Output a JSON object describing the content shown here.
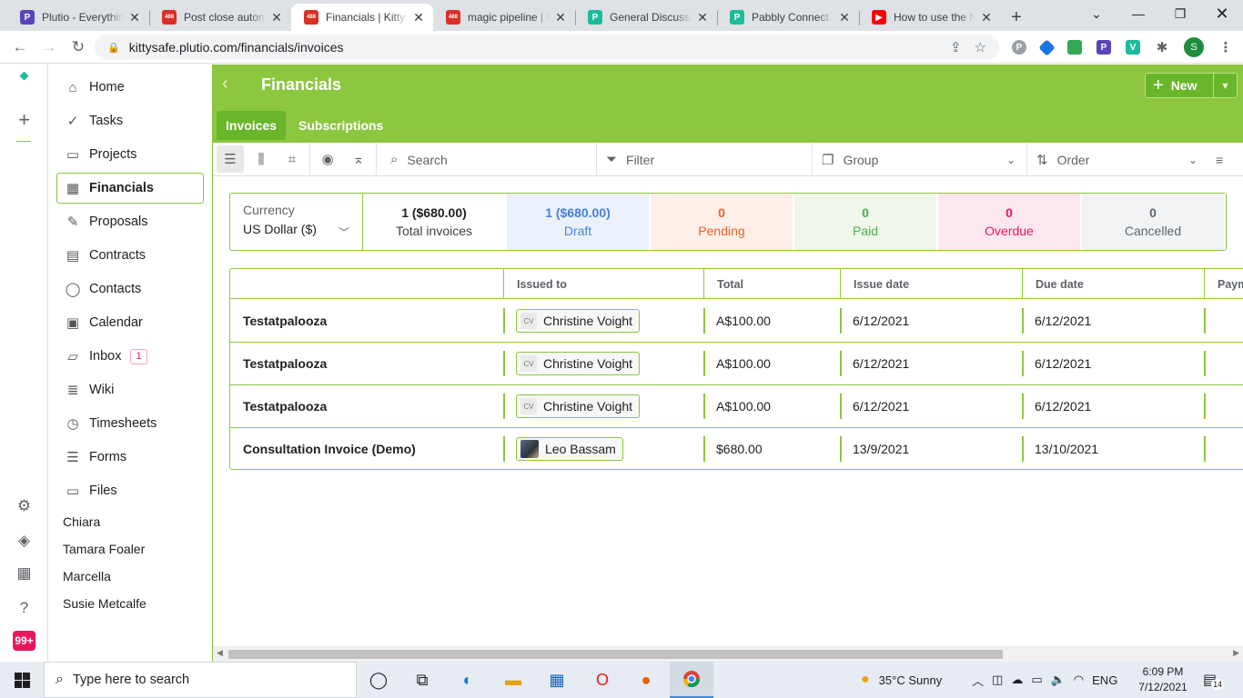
{
  "browser": {
    "tabs": [
      {
        "title": "Plutio - Everything",
        "fav_color": "#5b44ba",
        "fav_text": "P",
        "active": false
      },
      {
        "title": "Post close automation",
        "fav_color": "#d93025",
        "fav_text": "488",
        "active": false
      },
      {
        "title": "Financials | Kittysafe",
        "fav_color": "#d93025",
        "fav_text": "488",
        "active": true
      },
      {
        "title": "magic pipeline | Kittysafe",
        "fav_color": "#d93025",
        "fav_text": "488",
        "active": false
      },
      {
        "title": "General Discussion",
        "fav_color": "#1bbc9b",
        "fav_text": "P",
        "active": false
      },
      {
        "title": "Pabbly Connect",
        "fav_color": "#1bbc9b",
        "fav_text": "P",
        "active": false
      },
      {
        "title": "How to use the New",
        "fav_color": "#ff0000",
        "fav_text": "▶",
        "active": false
      }
    ],
    "url": "kittysafe.plutio.com/financials/invoices",
    "profile_initial": "S"
  },
  "rail": {
    "notification_count": "99+"
  },
  "sidebar": {
    "items": [
      {
        "label": "Home",
        "icon": "home-icon",
        "glyph": "⌂"
      },
      {
        "label": "Tasks",
        "icon": "check-icon",
        "glyph": "✓"
      },
      {
        "label": "Projects",
        "icon": "briefcase-icon",
        "glyph": "▭"
      },
      {
        "label": "Financials",
        "icon": "calculator-icon",
        "glyph": "▦",
        "active": true
      },
      {
        "label": "Proposals",
        "icon": "pen-icon",
        "glyph": "✎"
      },
      {
        "label": "Contracts",
        "icon": "contract-icon",
        "glyph": "▤"
      },
      {
        "label": "Contacts",
        "icon": "person-icon",
        "glyph": "◯"
      },
      {
        "label": "Calendar",
        "icon": "calendar-icon",
        "glyph": "▣"
      },
      {
        "label": "Inbox",
        "icon": "inbox-icon",
        "glyph": "▱",
        "count": "1"
      },
      {
        "label": "Wiki",
        "icon": "doc-icon",
        "glyph": "≣"
      },
      {
        "label": "Timesheets",
        "icon": "clock-icon",
        "glyph": "◷"
      },
      {
        "label": "Forms",
        "icon": "form-icon",
        "glyph": "☰"
      },
      {
        "label": "Files",
        "icon": "folder-icon",
        "glyph": "▭"
      }
    ],
    "people": [
      "Chiara",
      "Tamara Foaler",
      "Marcella",
      "Susie Metcalfe"
    ]
  },
  "header": {
    "title": "Financials",
    "new_label": "New",
    "tabs": [
      "Invoices",
      "Subscriptions"
    ]
  },
  "filterbar": {
    "search_placeholder": "Search",
    "filter_label": "Filter",
    "group_label": "Group",
    "order_label": "Order"
  },
  "stats": {
    "currency_label": "Currency",
    "currency_value": "US Dollar ($)",
    "cards": [
      {
        "value": "1 ($680.00)",
        "label": "Total invoices",
        "color": "#202124",
        "label_color": "#3c4043",
        "bg": "#ffffff"
      },
      {
        "value": "1 ($680.00)",
        "label": "Draft",
        "color": "#4a7fd4",
        "label_color": "#4a7fd4",
        "bg": "#eaf1fb"
      },
      {
        "value": "0",
        "label": "Pending",
        "color": "#e8622e",
        "label_color": "#e8622e",
        "bg": "#fdeee8"
      },
      {
        "value": "0",
        "label": "Paid",
        "color": "#4caf50",
        "label_color": "#4caf50",
        "bg": "#eef7ea"
      },
      {
        "value": "0",
        "label": "Overdue",
        "color": "#e8175d",
        "label_color": "#e8175d",
        "bg": "#fde7ef"
      },
      {
        "value": "0",
        "label": "Cancelled",
        "color": "#5f6368",
        "label_color": "#5f6368",
        "bg": "#f1f3f4"
      }
    ]
  },
  "table": {
    "columns": [
      "Issued to",
      "Total",
      "Issue date",
      "Due date",
      "Paym"
    ],
    "rows": [
      {
        "name": "Testatpalooza",
        "client": "Christine Voight",
        "initials": "CV",
        "photo": false,
        "total": "A$100.00",
        "issue": "6/12/2021",
        "due": "6/12/2021"
      },
      {
        "name": "Testatpalooza",
        "client": "Christine Voight",
        "initials": "CV",
        "photo": false,
        "total": "A$100.00",
        "issue": "6/12/2021",
        "due": "6/12/2021"
      },
      {
        "name": "Testatpalooza",
        "client": "Christine Voight",
        "initials": "CV",
        "photo": false,
        "total": "A$100.00",
        "issue": "6/12/2021",
        "due": "6/12/2021"
      },
      {
        "name": "Consultation Invoice (Demo)",
        "client": "Leo Bassam",
        "initials": "",
        "photo": true,
        "total": "$680.00",
        "issue": "13/9/2021",
        "due": "13/10/2021"
      }
    ]
  },
  "taskbar": {
    "search_placeholder": "Type here to search",
    "weather": "35°C  Sunny",
    "language": "ENG",
    "time": "6:09 PM",
    "date": "7/12/2021",
    "notifications": "14"
  },
  "colors": {
    "brand_green": "#8dc63f",
    "brand_green_dark": "#6ab62a"
  }
}
